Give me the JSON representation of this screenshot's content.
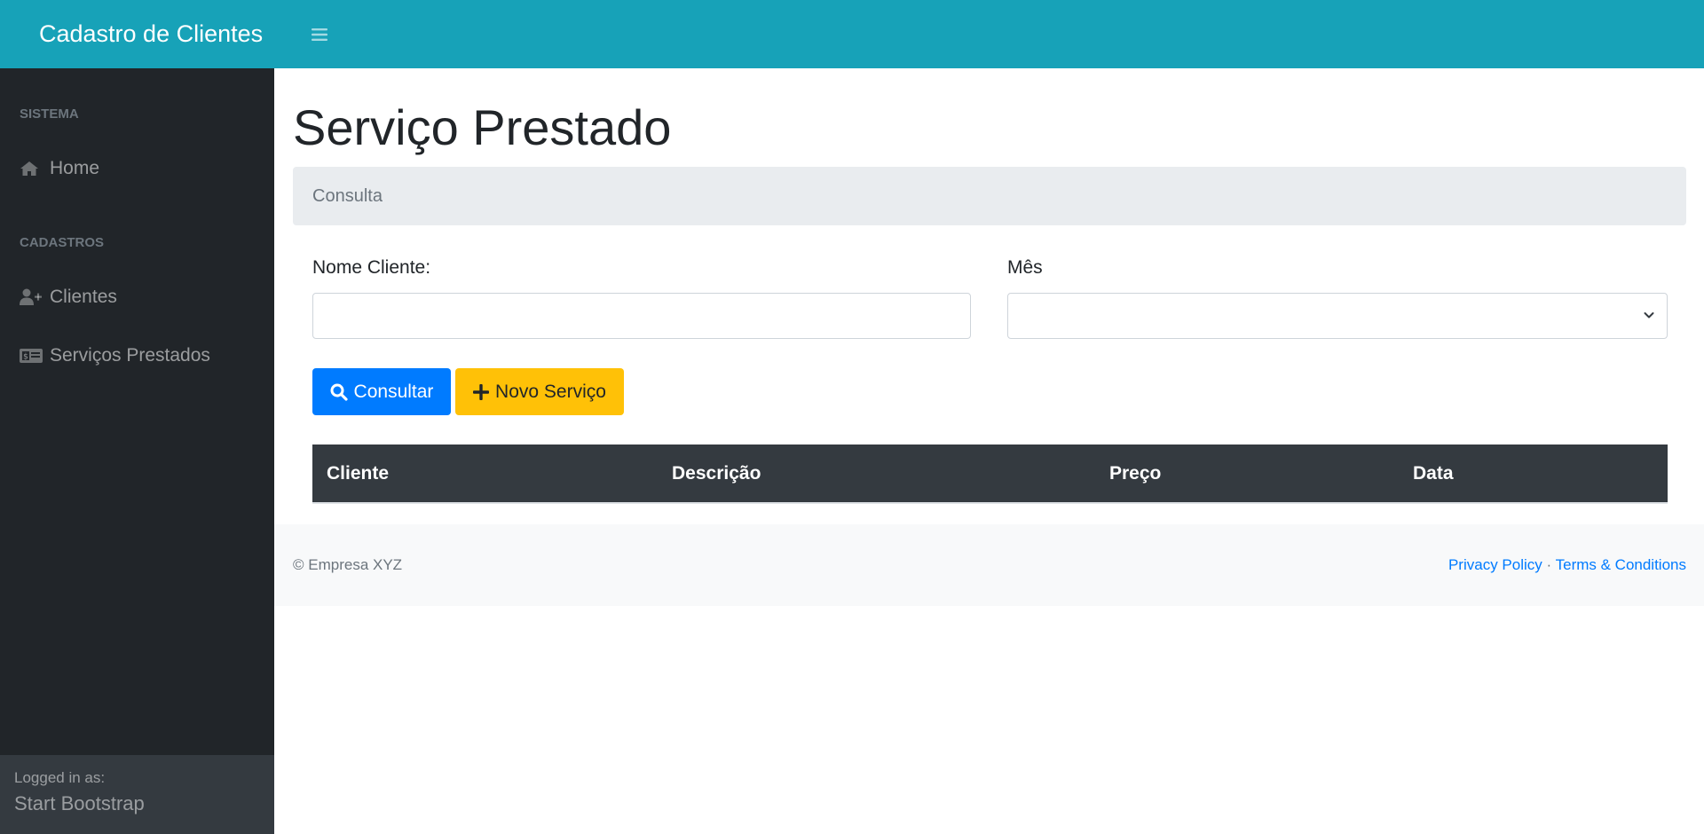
{
  "topnav": {
    "brand": "Cadastro de Clientes",
    "toggle_icon": "bars-icon"
  },
  "sidebar": {
    "sections": [
      {
        "heading": "Sistema",
        "items": [
          {
            "label": "Home",
            "icon": "home-icon"
          }
        ]
      },
      {
        "heading": "Cadastros",
        "items": [
          {
            "label": "Clientes",
            "icon": "user-plus-icon"
          },
          {
            "label": "Serviços Prestados",
            "icon": "money-card-icon"
          }
        ]
      }
    ],
    "footer": {
      "small": "Logged in as:",
      "user": "Start Bootstrap"
    }
  },
  "main": {
    "title": "Serviço Prestado",
    "breadcrumb": "Consulta",
    "form": {
      "nome_label": "Nome Cliente:",
      "nome_value": "",
      "mes_label": "Mês",
      "mes_value": ""
    },
    "buttons": {
      "consultar": "Consultar",
      "novo": "Novo Serviço"
    },
    "table": {
      "headers": [
        "Cliente",
        "Descrição",
        "Preço",
        "Data"
      ],
      "rows": []
    }
  },
  "footer": {
    "copyright": "© Empresa XYZ",
    "privacy": "Privacy Policy",
    "separator": "·",
    "terms": "Terms & Conditions"
  },
  "colors": {
    "topnav": "#17a2b8",
    "sidebar": "#212529",
    "primary": "#007bff",
    "warning": "#ffc107",
    "table_head": "#343a40"
  }
}
